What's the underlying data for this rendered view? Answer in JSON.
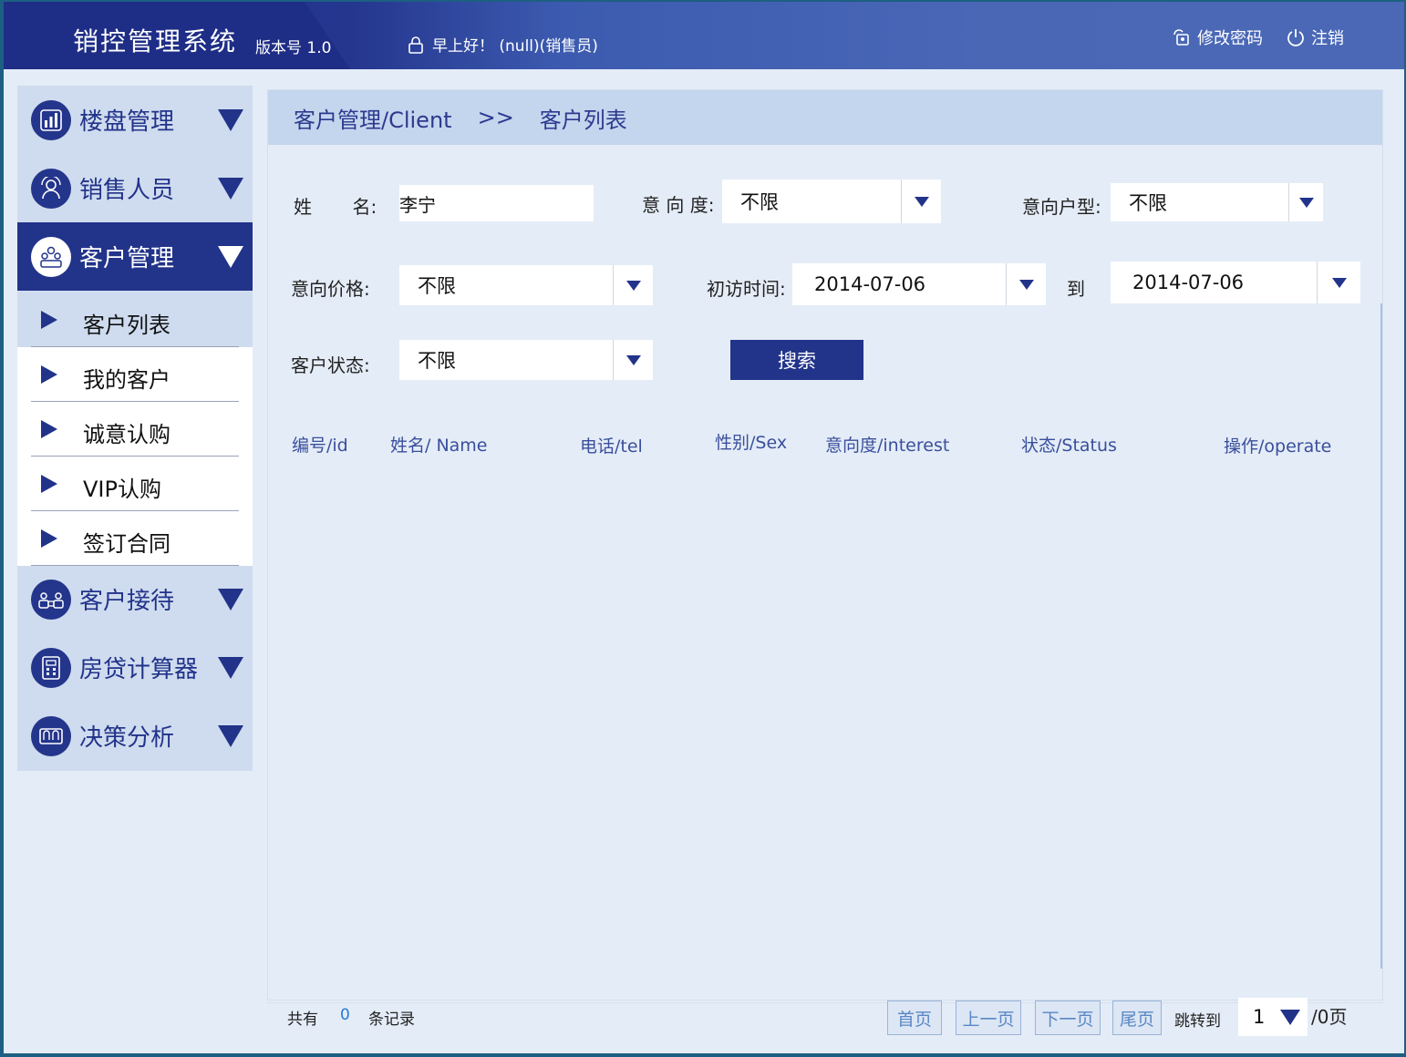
{
  "header": {
    "title": "销控管理系统",
    "version": "版本号 1.0",
    "greeting": "早上好！ (null)(销售员)",
    "change_password": "修改密码",
    "logout": "注销"
  },
  "sidebar": {
    "menu": [
      {
        "label": "楼盘管理",
        "icon": "bar-chart-icon"
      },
      {
        "label": "销售人员",
        "icon": "salesperson-icon"
      },
      {
        "label": "客户管理",
        "icon": "customers-icon",
        "active": true
      },
      {
        "label": "客户接待",
        "icon": "reception-icon"
      },
      {
        "label": "房贷计算器",
        "icon": "calculator-icon"
      },
      {
        "label": "决策分析",
        "icon": "analysis-icon"
      }
    ],
    "submenu": [
      {
        "label": "客户列表",
        "selected": true
      },
      {
        "label": "我的客户"
      },
      {
        "label": "诚意认购"
      },
      {
        "label": "VIP认购"
      },
      {
        "label": "签订合同"
      }
    ]
  },
  "breadcrumb": {
    "section": "客户管理/Client",
    "sep": ">>",
    "page": "客户列表"
  },
  "filters": {
    "name_label": "姓       名:",
    "name_value": "李宁",
    "intent_label": "意 向 度:",
    "intent_value": "不限",
    "house_type_label": "意向户型:",
    "house_type_value": "不限",
    "price_label": "意向价格:",
    "price_value": "不限",
    "visit_label": "初访时间:",
    "visit_from": "2014-07-06",
    "to_label": "到",
    "visit_to": "2014-07-06",
    "status_label": "客户状态:",
    "status_value": "不限",
    "search_label": "搜索"
  },
  "table": {
    "columns": [
      "编号/id",
      "姓名/ Name",
      "电话/tel",
      "性别/Sex",
      "意向度/interest",
      "状态/Status",
      "操作/operate"
    ],
    "rows": []
  },
  "footer": {
    "total_prefix": "共有",
    "total_count": "0",
    "total_suffix": "条记录",
    "first": "首页",
    "prev": "上一页",
    "next": "下一页",
    "last": "尾页",
    "jump_label": "跳转到",
    "jump_value": "1",
    "page_total": "/0页"
  },
  "colors": {
    "primary": "#22338a",
    "header_right": "#4a68b6",
    "panel_bg": "#e4ecf7",
    "breadcrumb_bg": "#c4d5ee"
  }
}
